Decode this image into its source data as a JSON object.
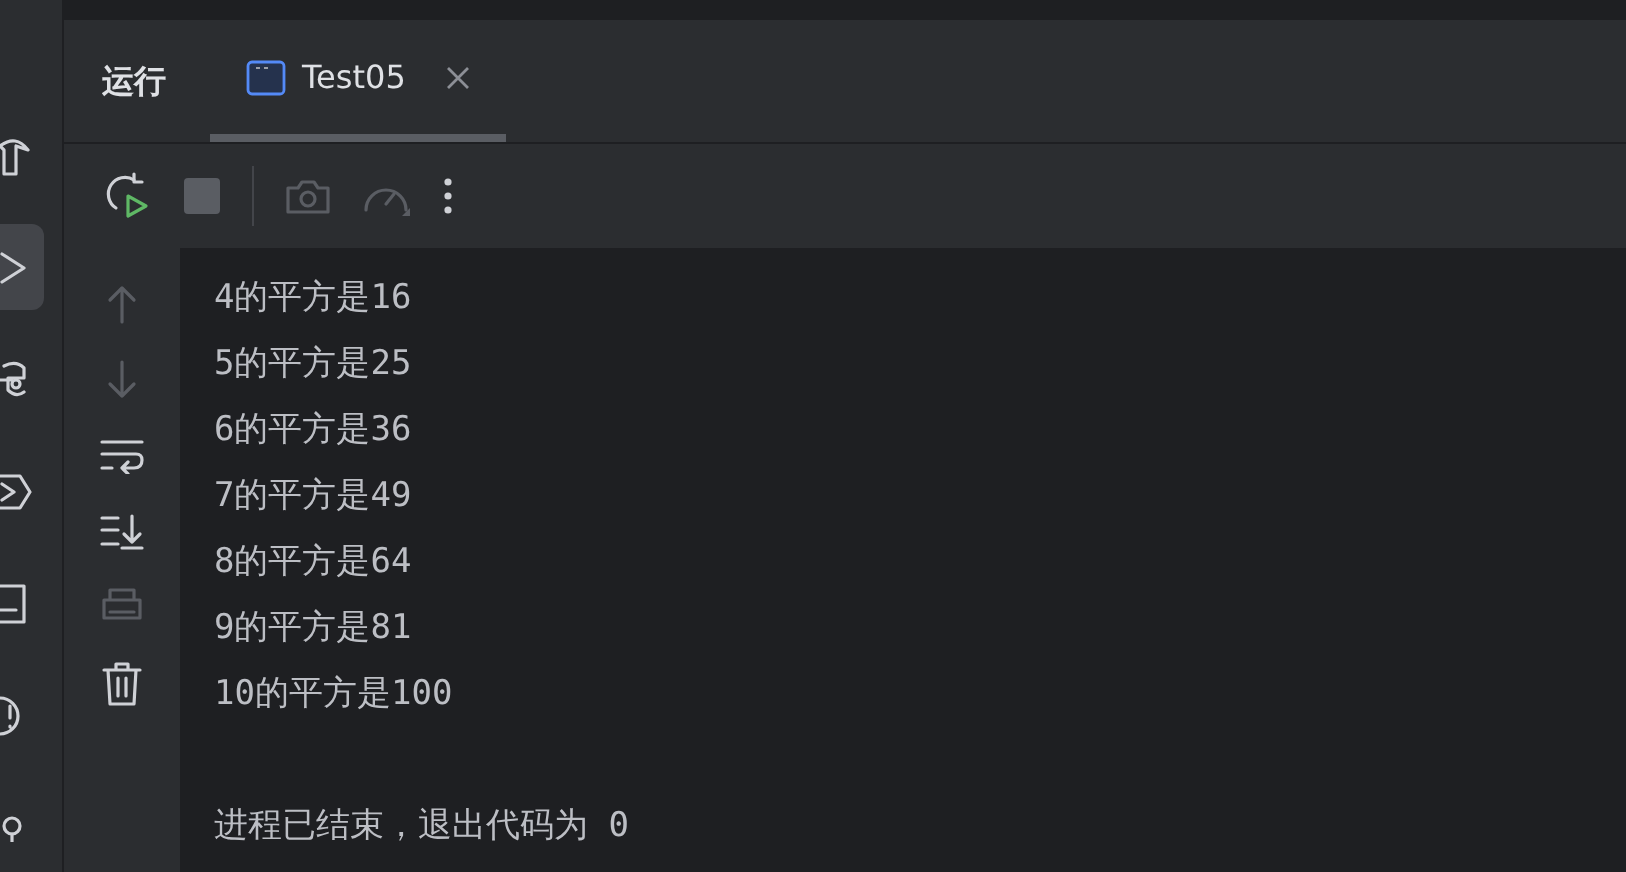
{
  "left_toolbar": [
    {
      "kind": "hammer",
      "selected": false
    },
    {
      "kind": "run",
      "selected": true
    },
    {
      "kind": "python",
      "selected": false
    },
    {
      "kind": "services",
      "selected": false
    },
    {
      "kind": "terminal",
      "selected": false
    },
    {
      "kind": "problems",
      "selected": false
    },
    {
      "kind": "git",
      "selected": false
    }
  ],
  "panel": {
    "title": "运行",
    "tabs": [
      {
        "label": "Test05",
        "selected": true
      }
    ]
  },
  "toolbar": [
    {
      "kind": "rerun",
      "disabled": false
    },
    {
      "kind": "stop",
      "disabled": true
    },
    {
      "kind": "camera",
      "disabled": true
    },
    {
      "kind": "gauge",
      "disabled": true
    },
    {
      "kind": "more",
      "disabled": false
    }
  ],
  "gutter": [
    {
      "kind": "up",
      "disabled": true
    },
    {
      "kind": "down",
      "disabled": true
    },
    {
      "kind": "wrap",
      "disabled": false
    },
    {
      "kind": "scroll-end",
      "disabled": false
    },
    {
      "kind": "print",
      "disabled": true
    },
    {
      "kind": "trash",
      "disabled": false
    }
  ],
  "output": [
    "4的平方是16",
    "5的平方是25",
    "6的平方是36",
    "7的平方是49",
    "8的平方是64",
    "9的平方是81",
    "10的平方是100"
  ],
  "exit_message": "进程已结束，退出代码为 0"
}
